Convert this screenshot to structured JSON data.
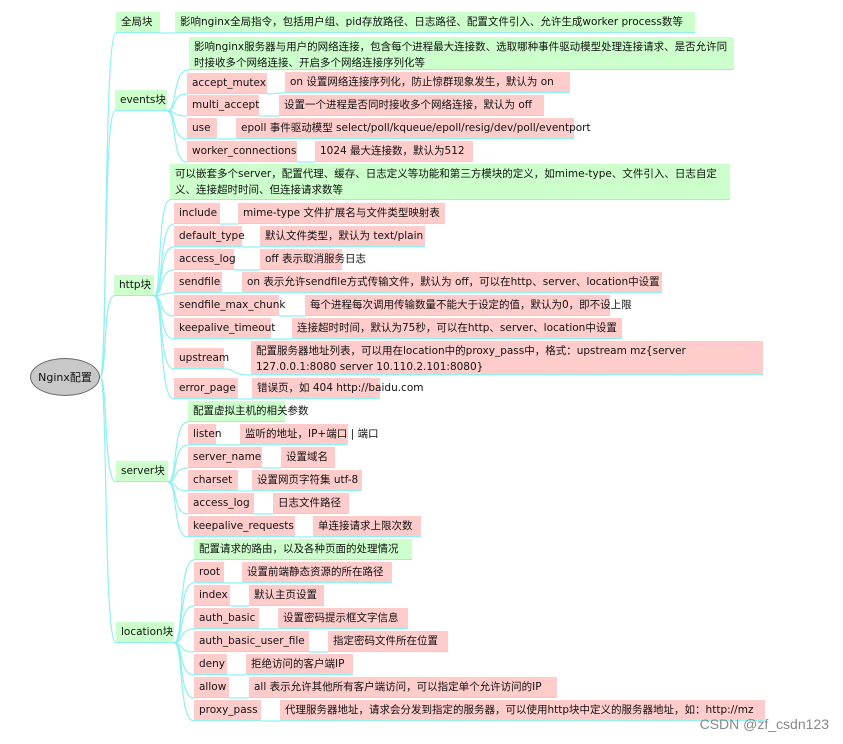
{
  "root": "Nginx配置",
  "colors": {
    "branch": "#ccffcc",
    "leaf": "#ffcccc",
    "connector": "#8ff0f0",
    "root": "#c8c8c8"
  },
  "branches": [
    {
      "label": "全局块",
      "desc": "影响nginx全局指令，包括用户组、pid存放路径、日志路径、配置文件引入、允许生成worker process数等",
      "children": []
    },
    {
      "label": "events块",
      "desc": "影响nginx服务器与用户的网络连接，包含每个进程最大连接数、选取哪种事件驱动模型处理连接请求、是否允许同时接收多个网络连接、开启多个网络连接序列化等",
      "children": [
        {
          "key": "accept_mutex",
          "desc": "on 设置网络连接序列化，防止惊群现象发生，默认为 on"
        },
        {
          "key": "multi_accept",
          "desc": "设置一个进程是否同时接收多个网络连接，默认为 off"
        },
        {
          "key": "use",
          "desc": "epoll 事件驱动模型 select/poll/kqueue/epoll/resig/dev/poll/eventport"
        },
        {
          "key": "worker_connections",
          "desc": "1024 最大连接数，默认为512"
        }
      ]
    },
    {
      "label": "http块",
      "desc": "可以嵌套多个server，配置代理、缓存、日志定义等功能和第三方模块的定义，如mime-type、文件引入、日志自定义、连接超时时间、但连接请求数等",
      "children": [
        {
          "key": "include",
          "desc": "mime-type 文件扩展名与文件类型映射表"
        },
        {
          "key": "default_type",
          "desc": "默认文件类型，默认为 text/plain"
        },
        {
          "key": "access_log",
          "desc": "off 表示取消服务日志"
        },
        {
          "key": "sendfile",
          "desc": "on 表示允许sendfile方式传输文件，默认为 off，可以在http、server、location中设置"
        },
        {
          "key": "sendfile_max_chunk",
          "desc": "每个进程每次调用传输数量不能大于设定的值，默认为0，即不设上限"
        },
        {
          "key": "keepalive_timeout",
          "desc": "连接超时时间，默认为75秒，可以在http、server、location中设置"
        },
        {
          "key": "upstream",
          "desc": "配置服务器地址列表，可以用在location中的proxy_pass中，格式：upstream mz{server 127.0.0.1:8080 server 10.110.2.101:8080}"
        },
        {
          "key": "error_page",
          "desc": "错误页，如 404  http://baidu.com"
        }
      ]
    },
    {
      "label": "server块",
      "desc": "配置虚拟主机的相关参数",
      "children": [
        {
          "key": "listen",
          "desc": "监听的地址，IP+端口 | 端口"
        },
        {
          "key": "server_name",
          "desc": "设置域名"
        },
        {
          "key": "charset",
          "desc": "设置网页字符集 utf-8"
        },
        {
          "key": "access_log",
          "desc": "日志文件路径"
        },
        {
          "key": "keepalive_requests",
          "desc": "单连接请求上限次数"
        }
      ]
    },
    {
      "label": "location块",
      "desc": "配置请求的路由，以及各种页面的处理情况",
      "children": [
        {
          "key": "root",
          "desc": "设置前端静态资源的所在路径"
        },
        {
          "key": "index",
          "desc": "默认主页设置"
        },
        {
          "key": "auth_basic",
          "desc": "设置密码提示框文字信息"
        },
        {
          "key": "auth_basic_user_file",
          "desc": "指定密码文件所在位置"
        },
        {
          "key": "deny",
          "desc": "拒绝访问的客户端IP"
        },
        {
          "key": "allow",
          "desc": "all 表示允许其他所有客户端访问，可以指定单个允许访问的IP"
        },
        {
          "key": "proxy_pass",
          "desc": "代理服务器地址，请求会分发到指定的服务器，可以使用http块中定义的服务器地址，如：http://mz"
        }
      ]
    }
  ],
  "watermark": "CSDN @zf_csdn123"
}
